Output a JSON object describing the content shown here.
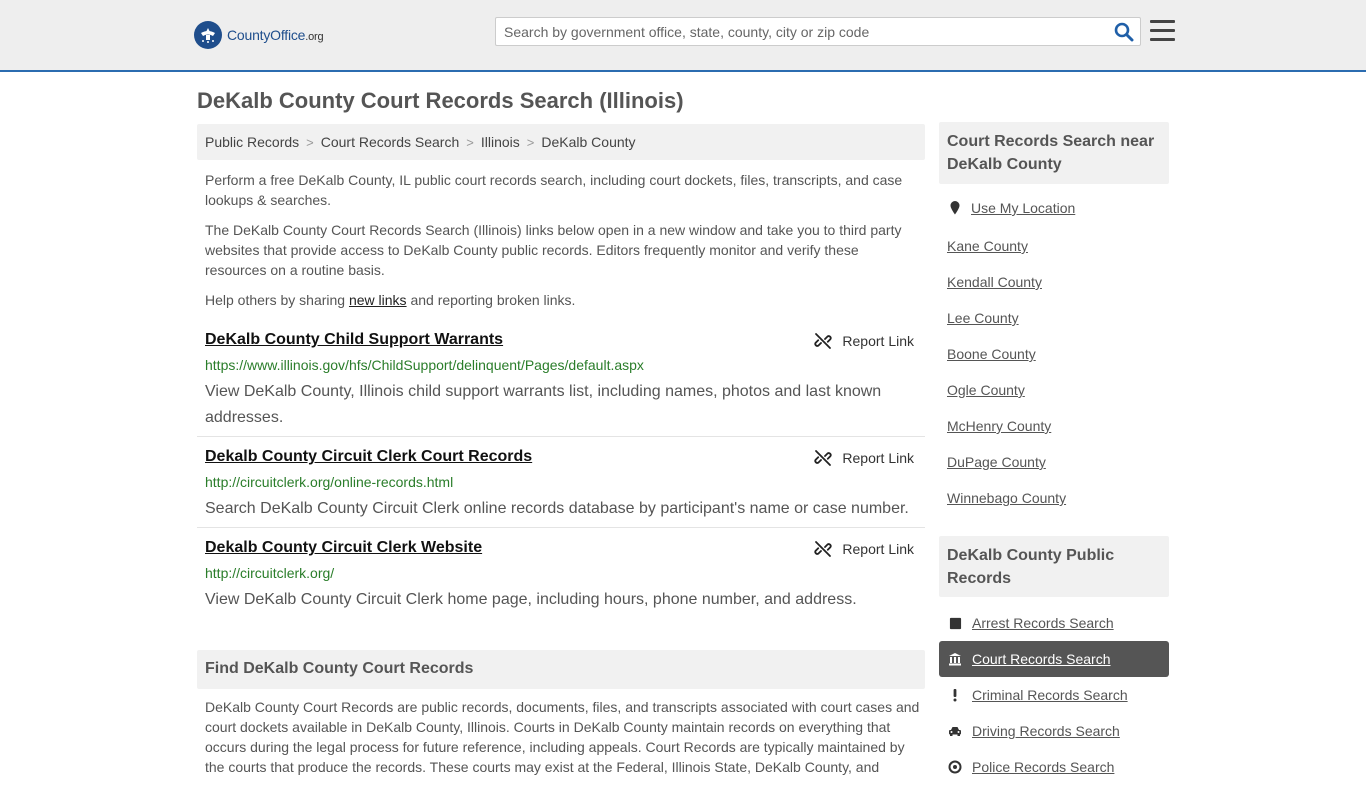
{
  "header": {
    "logo_main": "CountyOffice",
    "logo_tld": ".org",
    "search_placeholder": "Search by government office, state, county, city or zip code"
  },
  "page": {
    "title": "DeKalb County Court Records Search (Illinois)"
  },
  "breadcrumb": [
    "Public Records",
    "Court Records Search",
    "Illinois",
    "DeKalb County"
  ],
  "intro": {
    "p1": "Perform a free DeKalb County, IL public court records search, including court dockets, files, transcripts, and case lookups & searches.",
    "p2": "The DeKalb County Court Records Search (Illinois) links below open in a new window and take you to third party websites that provide access to DeKalb County public records. Editors frequently monitor and verify these resources on a routine basis.",
    "p3_before": "Help others by sharing ",
    "p3_link": "new links",
    "p3_after": " and reporting broken links."
  },
  "records": [
    {
      "title": "DeKalb County Child Support Warrants",
      "url": "https://www.illinois.gov/hfs/ChildSupport/delinquent/Pages/default.aspx",
      "description": "View DeKalb County, Illinois child support warrants list, including names, photos and last known addresses.",
      "report_label": "Report Link"
    },
    {
      "title": "Dekalb County Circuit Clerk Court Records",
      "url": "http://circuitclerk.org/online-records.html",
      "description": "Search DeKalb County Circuit Clerk online records database by participant's name or case number.",
      "report_label": "Report Link"
    },
    {
      "title": "Dekalb County Circuit Clerk Website",
      "url": "http://circuitclerk.org/",
      "description": "View DeKalb County Circuit Clerk home page, including hours, phone number, and address.",
      "report_label": "Report Link"
    }
  ],
  "find": {
    "heading": "Find DeKalb County Court Records",
    "text": "DeKalb County Court Records are public records, documents, files, and transcripts associated with court cases and court dockets available in DeKalb County, Illinois. Courts in DeKalb County maintain records on everything that occurs during the legal process for future reference, including appeals. Court Records are typically maintained by the courts that produce the records. These courts may exist at the Federal, Illinois State, DeKalb County, and"
  },
  "sidebar": {
    "near_heading": "Court Records Search near DeKalb County",
    "use_location": "Use My Location",
    "near_links": [
      "Kane County",
      "Kendall County",
      "Lee County",
      "Boone County",
      "Ogle County",
      "McHenry County",
      "DuPage County",
      "Winnebago County"
    ],
    "public_heading": "DeKalb County Public Records",
    "public_items": [
      {
        "label": "Arrest Records Search",
        "icon": "square-icon"
      },
      {
        "label": "Court Records Search",
        "icon": "courthouse-icon"
      },
      {
        "label": "Criminal Records Search",
        "icon": "exclamation-icon"
      },
      {
        "label": "Driving Records Search",
        "icon": "car-icon"
      },
      {
        "label": "Police Records Search",
        "icon": "police-icon"
      }
    ],
    "active_color": "#555555"
  },
  "colors": {
    "url_green": "#2a7d2a",
    "header_border": "#2b6cb0",
    "logo_blue": "#1f4e8c"
  }
}
